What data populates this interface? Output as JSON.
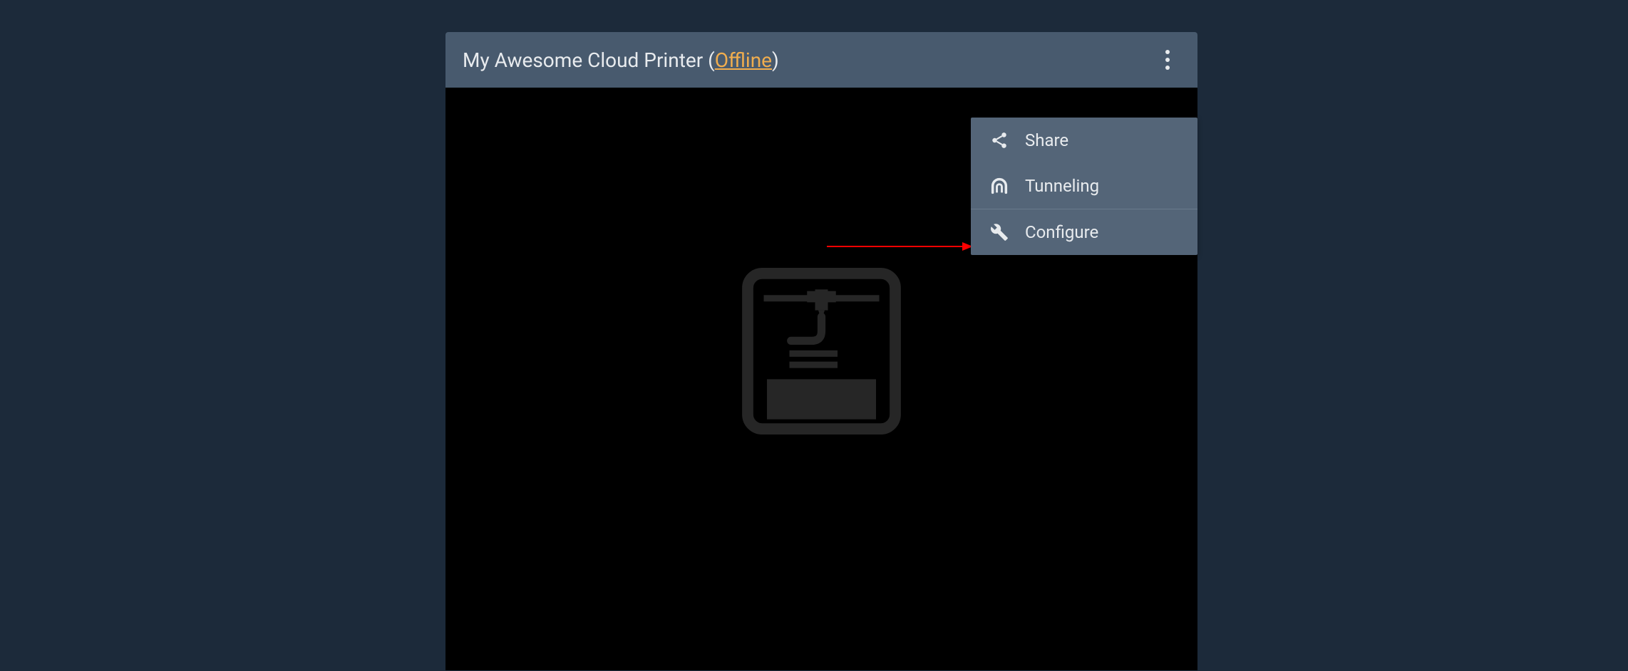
{
  "printer": {
    "name": "My Awesome Cloud Printer",
    "status_label": "Offline"
  },
  "menu": {
    "share_label": "Share",
    "tunneling_label": "Tunneling",
    "configure_label": "Configure"
  }
}
